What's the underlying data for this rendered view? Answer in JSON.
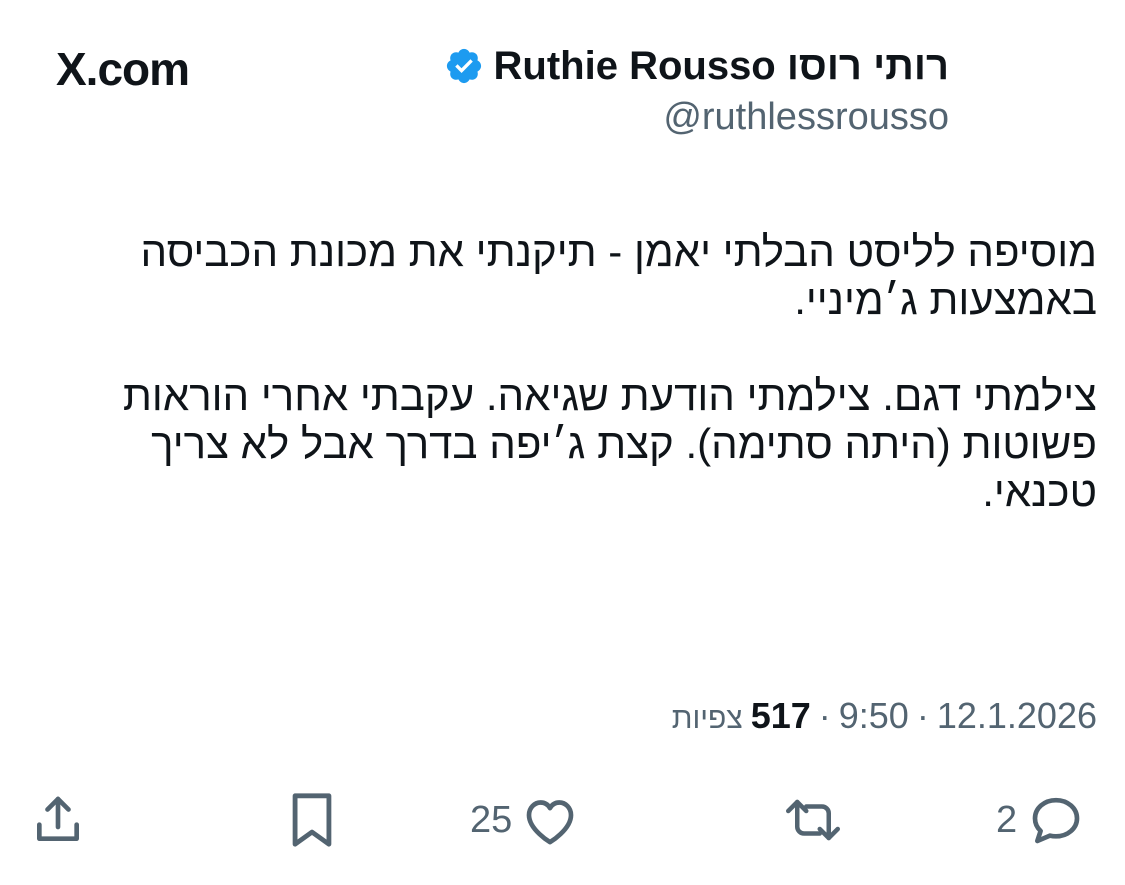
{
  "header": {
    "site_logo": "X.com",
    "author_name": "Ruthie Rousso רותי רוסו",
    "author_handle": "@ruthlessrousso",
    "verified_badge": "blue-check-icon"
  },
  "tweet": {
    "paragraphs": [
      "מוסיפה לליסט הבלתי יאמן - תיקנתי את מכונת הכביסה באמצעות ג׳מיניי.",
      "צילמתי דגם. צילמתי הודעת שגיאה. עקבתי אחרי הוראות פשוטות (היתה סתימה). קצת ג׳יפה בדרך אבל לא צריך טכנאי."
    ]
  },
  "meta": {
    "date": "12.1.2026",
    "separator_1": "·",
    "time": "9:50",
    "separator_2": "·",
    "views_count": "517",
    "views_label": "צפיות"
  },
  "actions": {
    "reply_count": "2",
    "retweet_count": "",
    "like_count": "25",
    "icons": [
      "reply-icon",
      "retweet-icon",
      "heart-icon",
      "bookmark-icon",
      "share-icon"
    ]
  },
  "colors": {
    "text_primary": "#0f1419",
    "text_secondary": "#536471",
    "verified_blue": "#1d9bf0",
    "background": "#ffffff"
  }
}
